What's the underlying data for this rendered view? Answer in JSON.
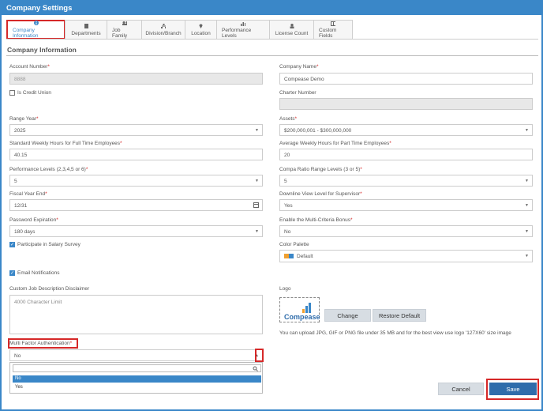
{
  "window": {
    "title": "Company Settings"
  },
  "tabs": [
    {
      "label": "Company Information",
      "icon": "info-icon"
    },
    {
      "label": "Departments",
      "icon": "building-icon"
    },
    {
      "label": "Job Family",
      "icon": "users-icon"
    },
    {
      "label": "Division/Branch",
      "icon": "sitemap-icon"
    },
    {
      "label": "Location",
      "icon": "map-pin-icon"
    },
    {
      "label": "Performance Levels",
      "icon": "bar-chart-icon"
    },
    {
      "label": "License Count",
      "icon": "user-plus-icon"
    },
    {
      "label": "Custom Fields",
      "icon": "table-icon"
    }
  ],
  "section": {
    "title": "Company Information"
  },
  "form": {
    "account_number": {
      "label": "Account Number",
      "value": "8888"
    },
    "company_name": {
      "label": "Company Name",
      "value": "Compease Demo"
    },
    "is_credit_union": {
      "label": "Is Credit Union"
    },
    "charter_number": {
      "label": "Charter Number",
      "value": ""
    },
    "range_year": {
      "label": "Range Year",
      "value": "2025"
    },
    "assets": {
      "label": "Assets",
      "value": "$200,000,001 - $300,000,000"
    },
    "std_weekly_hours": {
      "label": "Standard Weekly Hours for Full Time Employees",
      "value": "40.15"
    },
    "avg_weekly_hours": {
      "label": "Average Weekly Hours for Part Time Employees",
      "value": "20"
    },
    "performance_levels": {
      "label": "Performance Levels (2,3,4,5 or 6)",
      "value": "5"
    },
    "compa_ratio": {
      "label": "Compa Ratio Range Levels (3 or 5)",
      "value": "5"
    },
    "fiscal_year_end": {
      "label": "Fiscal Year End",
      "value": "12/31"
    },
    "downline_view": {
      "label": "Downline View Level for Supervisor",
      "value": "Yes"
    },
    "password_expiration": {
      "label": "Password Expiration",
      "value": "180 days"
    },
    "multi_criteria": {
      "label": "Enable the Multi-Criteria Bonus",
      "value": "No"
    },
    "salary_survey": {
      "label": "Participate in Salary Survey"
    },
    "color_palette": {
      "label": "Color Palette",
      "value": "Default"
    },
    "email_notifications": {
      "label": "Email Notifications"
    },
    "job_disclaimer": {
      "label": "Custom Job Description Disclaimer",
      "placeholder": "4000 Character Limit"
    },
    "mfa": {
      "label": "Multi Factor Authentication",
      "value": "No",
      "options": [
        "No",
        "Yes"
      ]
    },
    "logo": {
      "label": "Logo",
      "brand_text": "Compease",
      "change_label": "Change",
      "restore_label": "Restore Default",
      "help": "You can upload JPG, GIF or PNG file under 35 MB and for the best view use logo '127X60' size image"
    }
  },
  "actions": {
    "cancel_label": "Cancel",
    "save_label": "Save"
  },
  "colors": {
    "accent": "#3a87c8",
    "primary_button": "#2f6cab",
    "required": "#d62828",
    "highlight_frame": "#d62828"
  }
}
